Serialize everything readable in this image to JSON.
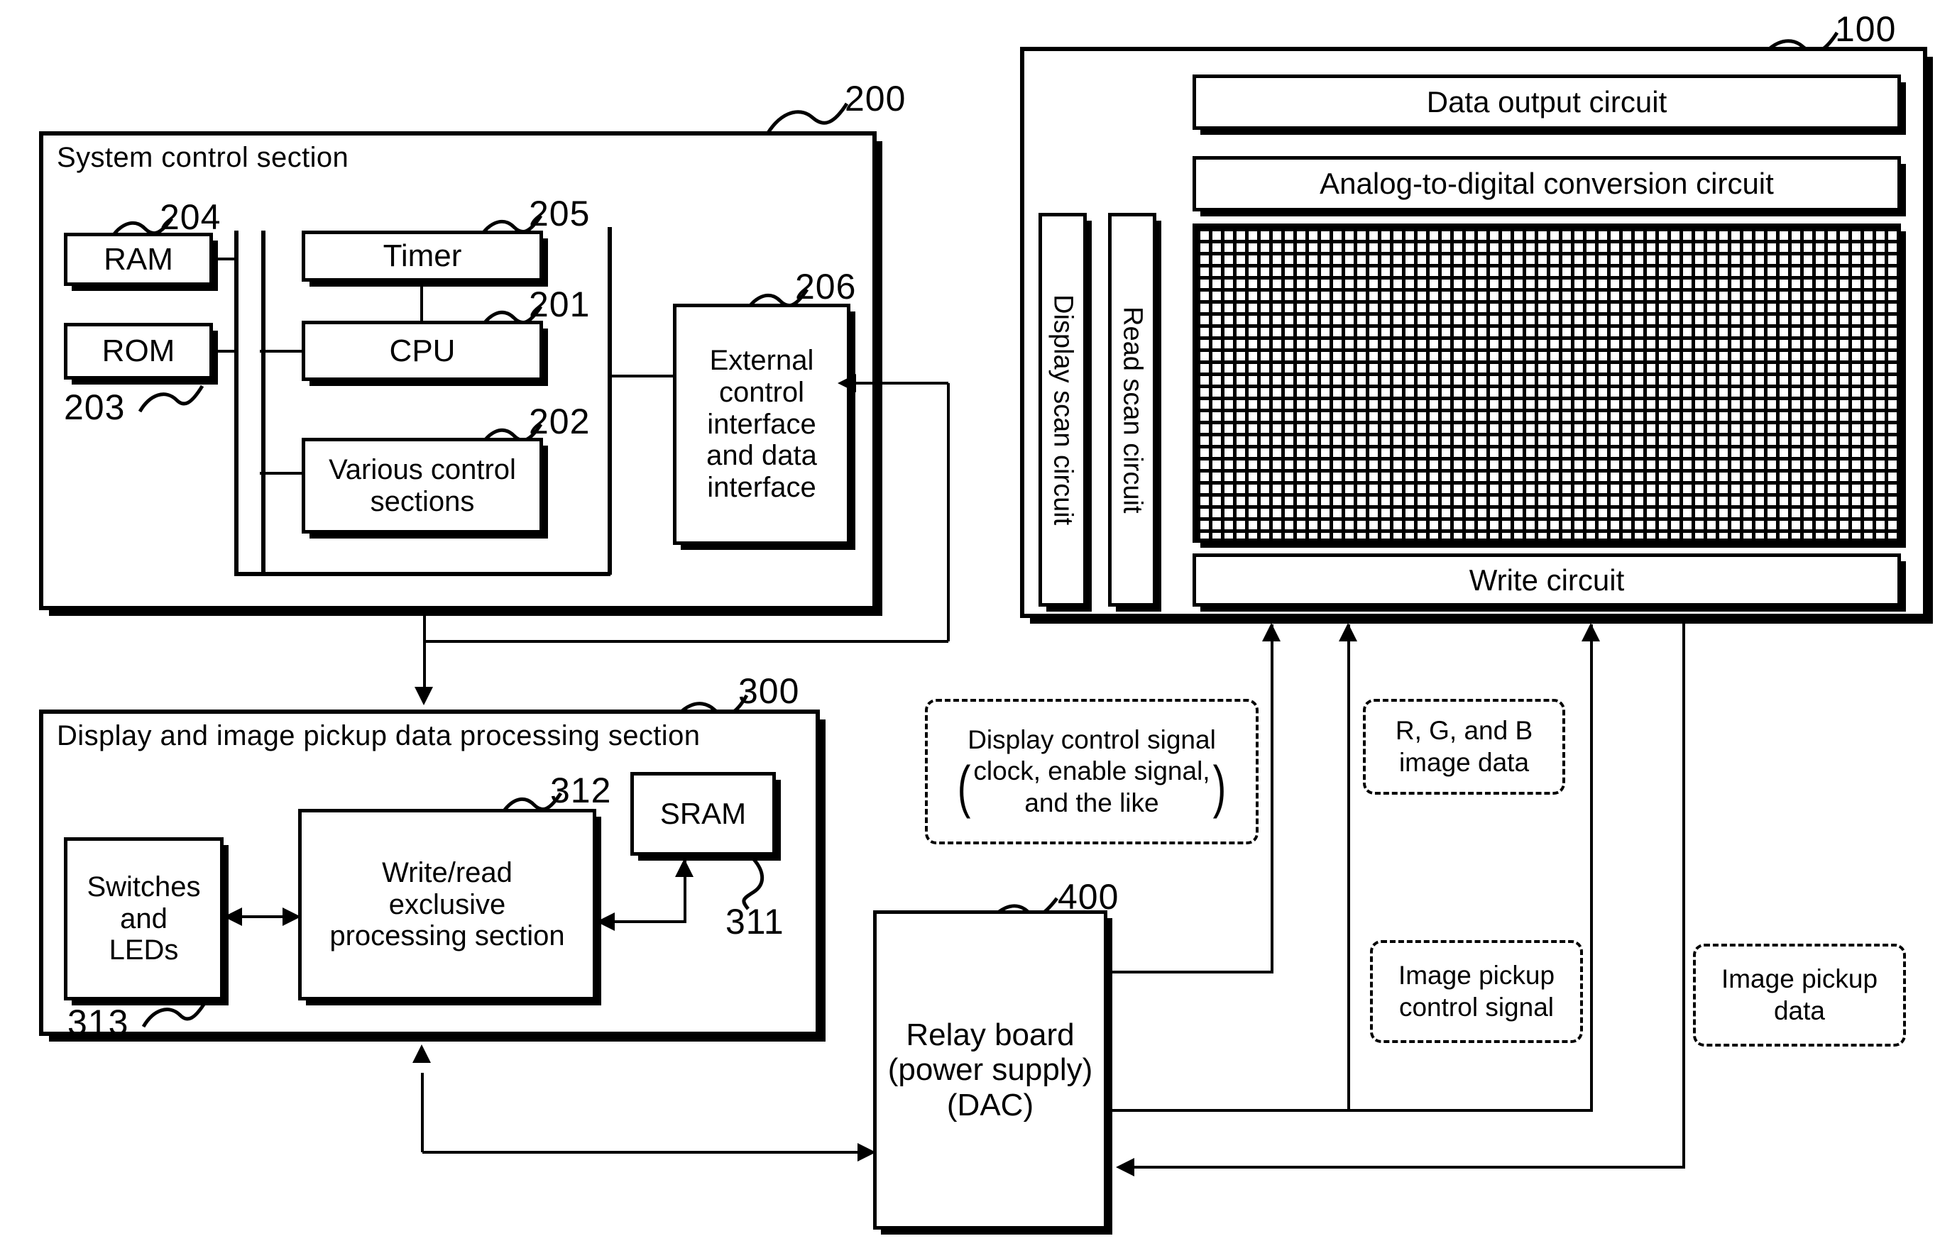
{
  "figure": {
    "type": "block-diagram",
    "description": "Display and image pickup apparatus block diagram"
  },
  "system_control": {
    "ref": "200",
    "title": "System control section",
    "blocks": {
      "ram": {
        "label": "RAM",
        "ref": "204"
      },
      "rom": {
        "label": "ROM",
        "ref": "203"
      },
      "timer": {
        "label": "Timer",
        "ref": "205"
      },
      "cpu": {
        "label": "CPU",
        "ref": "201"
      },
      "various": {
        "label": "Various control\nsections",
        "line1": "Various control",
        "line2": "sections",
        "ref": "202"
      },
      "external": {
        "ref": "206",
        "line1": "External",
        "line2": "control",
        "line3": "interface",
        "line4": "and data",
        "line5": "interface"
      }
    }
  },
  "processing_section": {
    "ref": "300",
    "title": "Display and image pickup data processing section",
    "blocks": {
      "switches": {
        "line1": "Switches",
        "line2": "and",
        "line3": "LEDs",
        "ref": "313"
      },
      "writeread": {
        "line1": "Write/read",
        "line2": "exclusive",
        "line3": "processing section",
        "ref": "312"
      },
      "sram": {
        "label": "SRAM",
        "ref": "311"
      }
    }
  },
  "display_device": {
    "ref": "100",
    "blocks": {
      "data_output": {
        "label": "Data output circuit"
      },
      "adc": {
        "label": "Analog-to-digital conversion circuit"
      },
      "write_circuit": {
        "label": "Write circuit"
      },
      "display_scan": {
        "label": "Display scan circuit"
      },
      "read_scan": {
        "label": "Read scan circuit"
      },
      "pixel_array": {
        "label": "pixel-array"
      }
    }
  },
  "relay_board": {
    "ref": "400",
    "line1": "Relay board",
    "line2": "(power supply)",
    "line3": "(DAC)"
  },
  "signals": {
    "display_control": {
      "line1": "Display control signal",
      "line2": "clock, enable signal,",
      "line3": "and the like"
    },
    "rgb": {
      "line1": "R, G, and B",
      "line2": "image data"
    },
    "pickup_control": {
      "line1": "Image pickup",
      "line2": "control signal"
    },
    "pickup_data": {
      "line1": "Image pickup",
      "line2": "data"
    }
  },
  "colors": {
    "ink": "#000000",
    "paper": "#ffffff"
  }
}
